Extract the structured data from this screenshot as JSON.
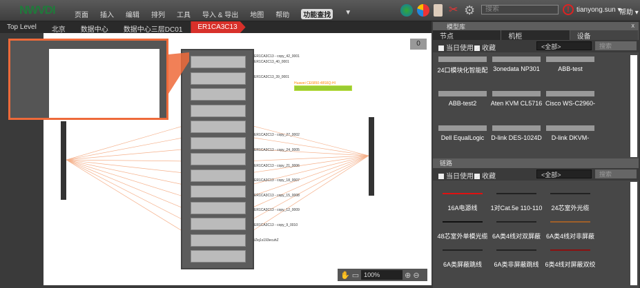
{
  "app": {
    "logo": "NWVDI"
  },
  "menu": [
    "页面",
    "插入",
    "编辑",
    "排列",
    "工具",
    "导入 & 导出",
    "地图",
    "帮助",
    "功能查找"
  ],
  "search_placeholder": "搜索",
  "user": "tianyong.sun ▾",
  "help": "帮助 ▾",
  "breadcrumb": [
    "Top Level",
    "北京",
    "数据中心",
    "数据中心三层DC01",
    "ER1CA3C13"
  ],
  "canvas": {
    "counter": "0",
    "zoom": "100%",
    "labels": [
      "ER1CA3C13 - copy_42_0001",
      "ER1CA3C13_40_0001",
      "ER1CA3C13_39_0001",
      "ER1CA3C13 - copy_27_0002",
      "ER1CA3C13 - copy_24_0005",
      "ER1CA3C13 - copy_21_0006",
      "ER1CA3C13 - copy_18_0007",
      "ER1CA3C13 - copy_15_0008",
      "ER1CA3C13 - copy_12_0009",
      "ER1CA3C13 - copy_9_0010",
      "iZiq1s193ecuhZ"
    ],
    "device_label": "Huawei CE6850-48S6Q-HI"
  },
  "panel": {
    "title": "模型库",
    "close": "x",
    "tabs": [
      "节点",
      "机柜",
      "设备"
    ],
    "filter": {
      "today": "当日使用",
      "fav": "收藏",
      "select": "<全部>",
      "search": "搜索",
      "clear": "x"
    },
    "devices": [
      "24口模块化智能配",
      "3onedata NP301",
      "ABB-test",
      "ABB-test2",
      "Aten KVM CL5716",
      "Cisco WS-C2960-",
      "Dell EqualLogic",
      "D-link DES-1024D",
      "D-link DKVM-"
    ],
    "links_title": "链路",
    "links": [
      {
        "name": "16A电源线",
        "color": "#e01010"
      },
      {
        "name": "1对Cat.5e 110-110",
        "color": "#222"
      },
      {
        "name": "24芯室外光缆",
        "color": "#222"
      },
      {
        "name": "48芯室外单模光缆",
        "color": "#111"
      },
      {
        "name": "6A类4线对双屏蔽",
        "color": "#222"
      },
      {
        "name": "6A类4线对非屏蔽",
        "color": "#a0602a"
      },
      {
        "name": "6A类屏蔽跳线",
        "color": "#222"
      },
      {
        "name": "6A类非屏蔽跳线",
        "color": "#222"
      },
      {
        "name": "6类4线对屏蔽双绞",
        "color": "#8a1010"
      }
    ]
  }
}
